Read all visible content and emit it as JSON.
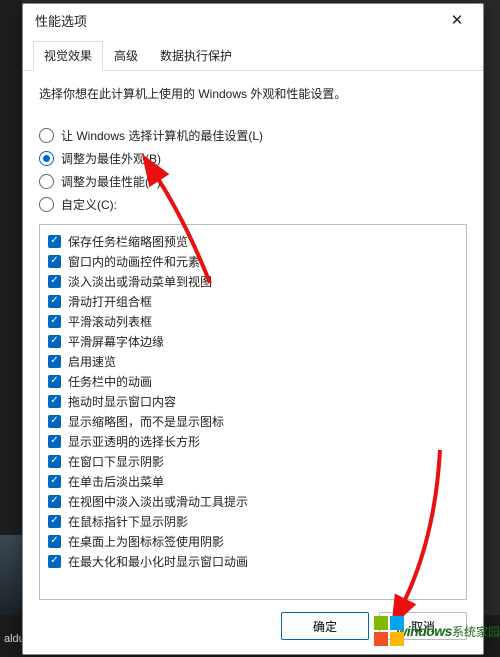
{
  "window": {
    "title": "性能选项",
    "close_glyph": "✕"
  },
  "tabs": [
    {
      "label": "视觉效果",
      "active": true
    },
    {
      "label": "高级",
      "active": false
    },
    {
      "label": "数据执行保护",
      "active": false
    }
  ],
  "description": "选择你想在此计算机上使用的 Windows 外观和性能设置。",
  "radios": [
    {
      "id": "auto",
      "label": "让 Windows 选择计算机的最佳设置(L)",
      "selected": false
    },
    {
      "id": "best-look",
      "label": "调整为最佳外观(B)",
      "selected": true
    },
    {
      "id": "best-perf",
      "label": "调整为最佳性能(P)",
      "selected": false
    },
    {
      "id": "custom",
      "label": "自定义(C):",
      "selected": false
    }
  ],
  "checks": [
    "保存任务栏缩略图预览",
    "窗口内的动画控件和元素",
    "淡入淡出或滑动菜单到视图",
    "滑动打开组合框",
    "平滑滚动列表框",
    "平滑屏幕字体边缘",
    "启用速览",
    "任务栏中的动画",
    "拖动时显示窗口内容",
    "显示缩略图，而不是显示图标",
    "显示亚透明的选择长方形",
    "在窗口下显示阴影",
    "在单击后淡出菜单",
    "在视图中淡入淡出或滑动工具提示",
    "在鼠标指针下显示阴影",
    "在桌面上为图标标签使用阴影",
    "在最大化和最小化时显示窗口动画"
  ],
  "buttons": {
    "ok": "确定",
    "cancel": "取消"
  },
  "watermark": {
    "en": "windows",
    "cn": "系统家园"
  },
  "taskbar": {
    "proc": "alduct.exc"
  }
}
